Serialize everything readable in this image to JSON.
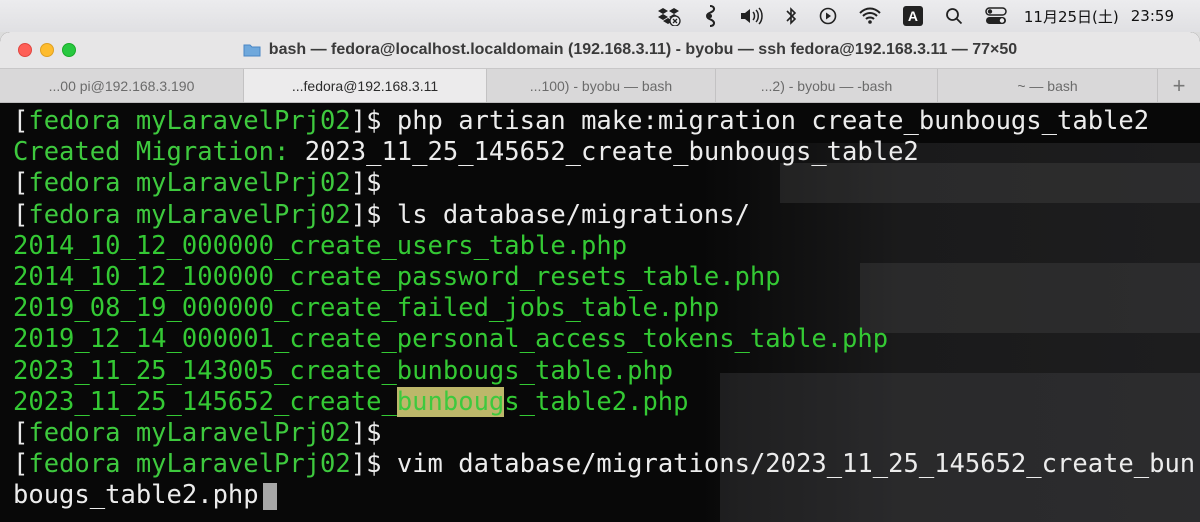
{
  "menubar": {
    "date": "11月25日(土)",
    "time": "23:59",
    "input_label": "A"
  },
  "window": {
    "title": "bash — fedora@localhost.localdomain (192.168.3.11) - byobu — ssh fedora@192.168.3.11 — 77×50",
    "tabs": [
      {
        "label": "...00 pi@192.168.3.190"
      },
      {
        "label": "...fedora@192.168.3.11"
      },
      {
        "label": "...100) - byobu — bash"
      },
      {
        "label": "...2) - byobu — -bash"
      },
      {
        "label": "~ — bash"
      }
    ],
    "new_tab_label": "+"
  },
  "terminal": {
    "prompt": "fedora myLaravelPrj02",
    "bracket_open": "[",
    "bracket_close": "]",
    "dollar": "$",
    "commands": {
      "make_migration": " php artisan make:migration create_bunbougs_table2",
      "ls": " ls database/migrations/",
      "vim": " vim database/migrations/2023_11_25_145652_create_bun"
    },
    "created_label": "Created Migration:",
    "created_value": " 2023_11_25_145652_create_bunbougs_table2",
    "files": [
      "2014_10_12_000000_create_users_table.php",
      "2014_10_12_100000_create_password_resets_table.php",
      "2019_08_19_000000_create_failed_jobs_table.php",
      "2019_12_14_000001_create_personal_access_tokens_table.php",
      "2023_11_25_143005_create_bunbougs_table.php"
    ],
    "last_file": {
      "before": "2023_11_25_145652_create_",
      "highlight": "bunboug",
      "after": "s_table2.php"
    },
    "wrapped_line": "bougs_table2.php"
  },
  "colors": {
    "prompt_green": "#3ec93e",
    "highlight": "#bdb76a",
    "terminal_bg": "#080808"
  }
}
